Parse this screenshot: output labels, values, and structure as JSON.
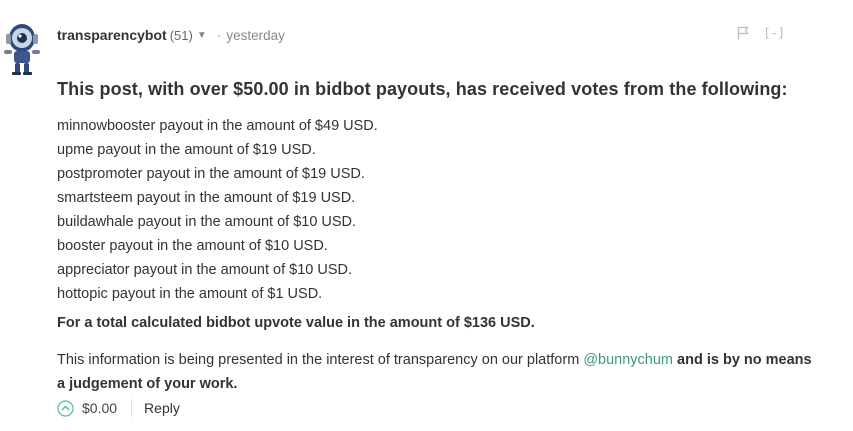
{
  "comment": {
    "author": "transparencybot",
    "reputation": "(51)",
    "timestamp": "yesterday",
    "separator_dot": "·",
    "collapse_label": "[-]",
    "heading": "This post, with over $50.00 in bidbot payouts, has received votes from the following:",
    "payouts": [
      "minnowbooster payout in the amount of $49 USD.",
      "upme payout in the amount of $19 USD.",
      "postpromoter payout in the amount of $19 USD.",
      "smartsteem payout in the amount of $19 USD.",
      "buildawhale payout in the amount of $10 USD.",
      "booster payout in the amount of $10 USD.",
      "appreciator payout in the amount of $10 USD.",
      "hottopic payout in the amount of $1 USD."
    ],
    "total": "For a total calculated bidbot upvote value in the amount of $136 USD.",
    "info_prefix": "This information is being presented in the interest of transparency on our platform ",
    "info_mention": "@bunnychum",
    "info_suffix": " and is by no means a judgement of your work.",
    "payout_value": "$0.00",
    "reply_label": "Reply"
  },
  "colors": {
    "mention": "#3a9a7a",
    "upvote": "#4dbfa0",
    "text": "#333333"
  },
  "icons": {
    "avatar": "robot-avatar-icon",
    "caret": "caret-down-icon",
    "flag": "flag-icon",
    "upvote": "upvote-chevron-icon"
  }
}
